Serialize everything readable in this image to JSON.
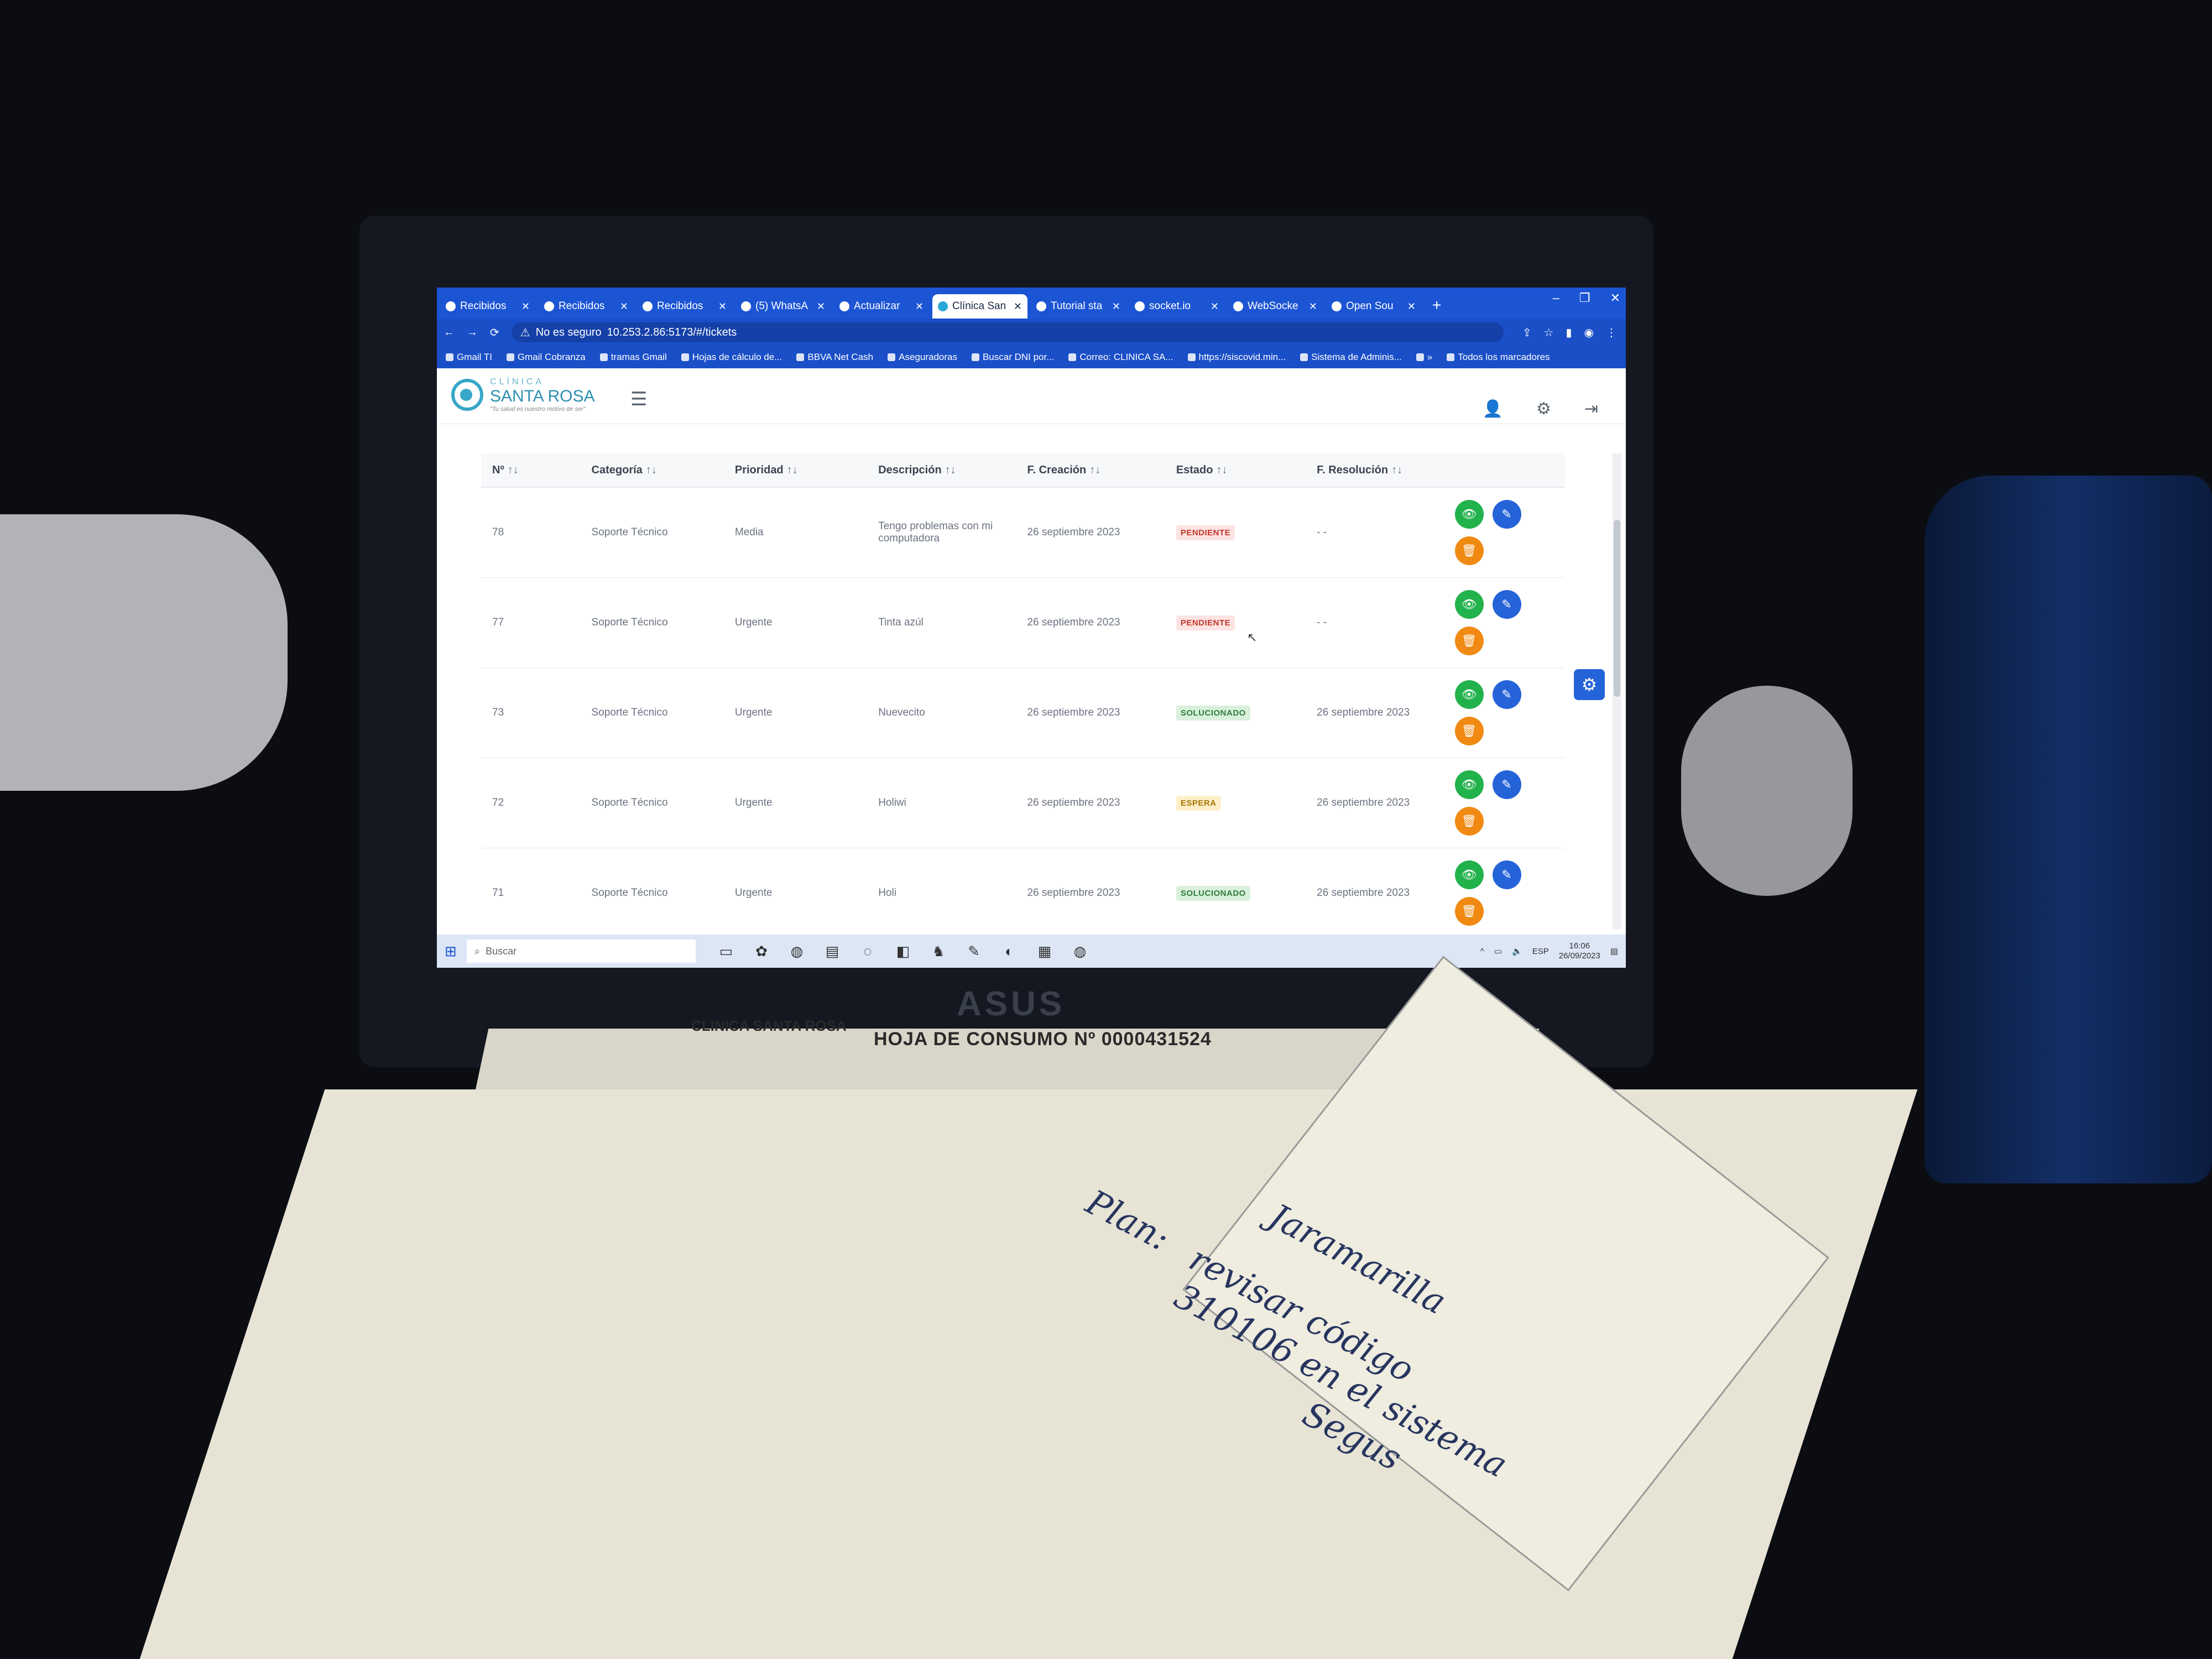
{
  "scene": {
    "monitor_brand": "ASUS",
    "paper": {
      "clinic": "CLINICA SANTA ROSA",
      "title": "HOJA DE CONSUMO Nº 0000431524",
      "handwriting": [
        "Plan:",
        "Jaramarilla",
        "revisar código",
        "310106 en el sistema",
        "Segus"
      ]
    }
  },
  "browser": {
    "tabs": [
      {
        "label": "Recibidos",
        "icon": "gmail-icon"
      },
      {
        "label": "Recibidos",
        "icon": "gmail-icon"
      },
      {
        "label": "Recibidos",
        "icon": "gmail-icon"
      },
      {
        "label": "(5) WhatsA",
        "icon": "whatsapp-icon"
      },
      {
        "label": "Actualizar",
        "icon": "page-icon"
      },
      {
        "label": "Clínica San",
        "icon": "clinic-icon",
        "active": true
      },
      {
        "label": "Tutorial sta",
        "icon": "page-icon"
      },
      {
        "label": "socket.io",
        "icon": "page-icon"
      },
      {
        "label": "WebSocke",
        "icon": "page-icon"
      },
      {
        "label": "Open Sou",
        "icon": "page-icon"
      }
    ],
    "new_tab": "+",
    "window_controls": {
      "minimize": "–",
      "restore": "❐",
      "close": "✕"
    },
    "security_label": "No es seguro",
    "url": "10.253.2.86:5173/#/tickets",
    "bookmarks": [
      "Gmail TI",
      "Gmail Cobranza",
      "tramas Gmail",
      "Hojas de cálculo de...",
      "BBVA Net Cash",
      "Aseguradoras",
      "Buscar DNI por...",
      "Correo: CLINICA SA...",
      "https://siscovid.min...",
      "Sistema de Adminis...",
      "»",
      "Todos los marcadores"
    ]
  },
  "app": {
    "logo": {
      "small": "CLÍNICA",
      "big": "SANTA ROSA",
      "tagline": "\"Tu salud es nuestro motivo de ser\""
    },
    "table": {
      "headers": {
        "no": "Nº",
        "categoria": "Categoría",
        "prioridad": "Prioridad",
        "descripcion": "Descripción",
        "f_creacion": "F. Creación",
        "estado": "Estado",
        "f_resolucion": "F. Resolución"
      },
      "sort_glyph": "↑↓",
      "rows": [
        {
          "no": "78",
          "categoria": "Soporte Técnico",
          "prioridad": "Media",
          "descripcion": "Tengo problemas con mi computadora",
          "f_creacion": "26 septiembre 2023",
          "estado": "PENDIENTE",
          "estado_kind": "pendiente",
          "f_resolucion": "- -"
        },
        {
          "no": "77",
          "categoria": "Soporte Técnico",
          "prioridad": "Urgente",
          "descripcion": "Tinta azúl",
          "f_creacion": "26 septiembre 2023",
          "estado": "PENDIENTE",
          "estado_kind": "pendiente",
          "f_resolucion": "- -"
        },
        {
          "no": "73",
          "categoria": "Soporte Técnico",
          "prioridad": "Urgente",
          "descripcion": "Nuevecito",
          "f_creacion": "26 septiembre 2023",
          "estado": "SOLUCIONADO",
          "estado_kind": "solucionado",
          "f_resolucion": "26 septiembre 2023"
        },
        {
          "no": "72",
          "categoria": "Soporte Técnico",
          "prioridad": "Urgente",
          "descripcion": "Holiwi",
          "f_creacion": "26 septiembre 2023",
          "estado": "ESPERA",
          "estado_kind": "espera",
          "f_resolucion": "26 septiembre 2023"
        },
        {
          "no": "71",
          "categoria": "Soporte Técnico",
          "prioridad": "Urgente",
          "descripcion": "Holi",
          "f_creacion": "26 septiembre 2023",
          "estado": "SOLUCIONADO",
          "estado_kind": "solucionado",
          "f_resolucion": "26 septiembre 2023"
        }
      ]
    }
  },
  "taskbar": {
    "search_placeholder": "Buscar",
    "language": "ESP",
    "time": "16:06",
    "date": "26/09/2023"
  },
  "colors": {
    "browser_blue": "#1c55d4",
    "view_button": "#22b24c",
    "edit_button": "#2563d9",
    "delete_button": "#f08a12"
  }
}
